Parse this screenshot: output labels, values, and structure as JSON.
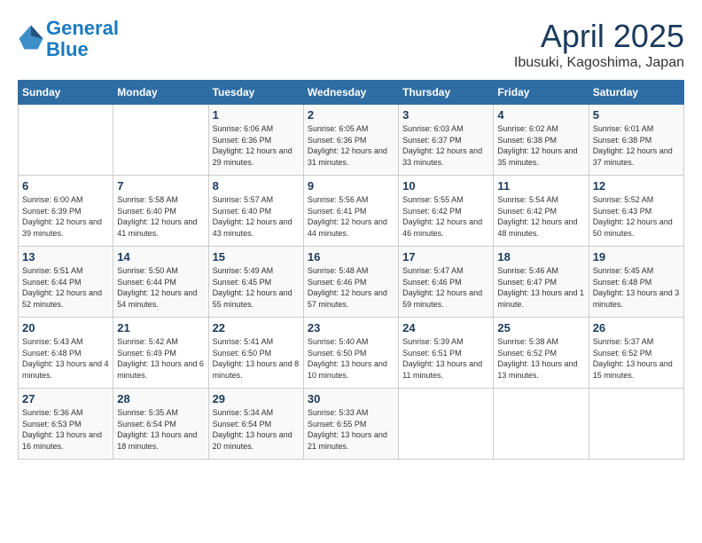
{
  "header": {
    "logo_line1": "General",
    "logo_line2": "Blue",
    "title": "April 2025",
    "subtitle": "Ibusuki, Kagoshima, Japan"
  },
  "weekdays": [
    "Sunday",
    "Monday",
    "Tuesday",
    "Wednesday",
    "Thursday",
    "Friday",
    "Saturday"
  ],
  "weeks": [
    [
      {
        "day": "",
        "info": ""
      },
      {
        "day": "",
        "info": ""
      },
      {
        "day": "1",
        "info": "Sunrise: 6:06 AM\nSunset: 6:36 PM\nDaylight: 12 hours\nand 29 minutes."
      },
      {
        "day": "2",
        "info": "Sunrise: 6:05 AM\nSunset: 6:36 PM\nDaylight: 12 hours\nand 31 minutes."
      },
      {
        "day": "3",
        "info": "Sunrise: 6:03 AM\nSunset: 6:37 PM\nDaylight: 12 hours\nand 33 minutes."
      },
      {
        "day": "4",
        "info": "Sunrise: 6:02 AM\nSunset: 6:38 PM\nDaylight: 12 hours\nand 35 minutes."
      },
      {
        "day": "5",
        "info": "Sunrise: 6:01 AM\nSunset: 6:38 PM\nDaylight: 12 hours\nand 37 minutes."
      }
    ],
    [
      {
        "day": "6",
        "info": "Sunrise: 6:00 AM\nSunset: 6:39 PM\nDaylight: 12 hours\nand 39 minutes."
      },
      {
        "day": "7",
        "info": "Sunrise: 5:58 AM\nSunset: 6:40 PM\nDaylight: 12 hours\nand 41 minutes."
      },
      {
        "day": "8",
        "info": "Sunrise: 5:57 AM\nSunset: 6:40 PM\nDaylight: 12 hours\nand 43 minutes."
      },
      {
        "day": "9",
        "info": "Sunrise: 5:56 AM\nSunset: 6:41 PM\nDaylight: 12 hours\nand 44 minutes."
      },
      {
        "day": "10",
        "info": "Sunrise: 5:55 AM\nSunset: 6:42 PM\nDaylight: 12 hours\nand 46 minutes."
      },
      {
        "day": "11",
        "info": "Sunrise: 5:54 AM\nSunset: 6:42 PM\nDaylight: 12 hours\nand 48 minutes."
      },
      {
        "day": "12",
        "info": "Sunrise: 5:52 AM\nSunset: 6:43 PM\nDaylight: 12 hours\nand 50 minutes."
      }
    ],
    [
      {
        "day": "13",
        "info": "Sunrise: 5:51 AM\nSunset: 6:44 PM\nDaylight: 12 hours\nand 52 minutes."
      },
      {
        "day": "14",
        "info": "Sunrise: 5:50 AM\nSunset: 6:44 PM\nDaylight: 12 hours\nand 54 minutes."
      },
      {
        "day": "15",
        "info": "Sunrise: 5:49 AM\nSunset: 6:45 PM\nDaylight: 12 hours\nand 55 minutes."
      },
      {
        "day": "16",
        "info": "Sunrise: 5:48 AM\nSunset: 6:46 PM\nDaylight: 12 hours\nand 57 minutes."
      },
      {
        "day": "17",
        "info": "Sunrise: 5:47 AM\nSunset: 6:46 PM\nDaylight: 12 hours\nand 59 minutes."
      },
      {
        "day": "18",
        "info": "Sunrise: 5:46 AM\nSunset: 6:47 PM\nDaylight: 13 hours\nand 1 minute."
      },
      {
        "day": "19",
        "info": "Sunrise: 5:45 AM\nSunset: 6:48 PM\nDaylight: 13 hours\nand 3 minutes."
      }
    ],
    [
      {
        "day": "20",
        "info": "Sunrise: 5:43 AM\nSunset: 6:48 PM\nDaylight: 13 hours\nand 4 minutes."
      },
      {
        "day": "21",
        "info": "Sunrise: 5:42 AM\nSunset: 6:49 PM\nDaylight: 13 hours\nand 6 minutes."
      },
      {
        "day": "22",
        "info": "Sunrise: 5:41 AM\nSunset: 6:50 PM\nDaylight: 13 hours\nand 8 minutes."
      },
      {
        "day": "23",
        "info": "Sunrise: 5:40 AM\nSunset: 6:50 PM\nDaylight: 13 hours\nand 10 minutes."
      },
      {
        "day": "24",
        "info": "Sunrise: 5:39 AM\nSunset: 6:51 PM\nDaylight: 13 hours\nand 11 minutes."
      },
      {
        "day": "25",
        "info": "Sunrise: 5:38 AM\nSunset: 6:52 PM\nDaylight: 13 hours\nand 13 minutes."
      },
      {
        "day": "26",
        "info": "Sunrise: 5:37 AM\nSunset: 6:52 PM\nDaylight: 13 hours\nand 15 minutes."
      }
    ],
    [
      {
        "day": "27",
        "info": "Sunrise: 5:36 AM\nSunset: 6:53 PM\nDaylight: 13 hours\nand 16 minutes."
      },
      {
        "day": "28",
        "info": "Sunrise: 5:35 AM\nSunset: 6:54 PM\nDaylight: 13 hours\nand 18 minutes."
      },
      {
        "day": "29",
        "info": "Sunrise: 5:34 AM\nSunset: 6:54 PM\nDaylight: 13 hours\nand 20 minutes."
      },
      {
        "day": "30",
        "info": "Sunrise: 5:33 AM\nSunset: 6:55 PM\nDaylight: 13 hours\nand 21 minutes."
      },
      {
        "day": "",
        "info": ""
      },
      {
        "day": "",
        "info": ""
      },
      {
        "day": "",
        "info": ""
      }
    ]
  ]
}
